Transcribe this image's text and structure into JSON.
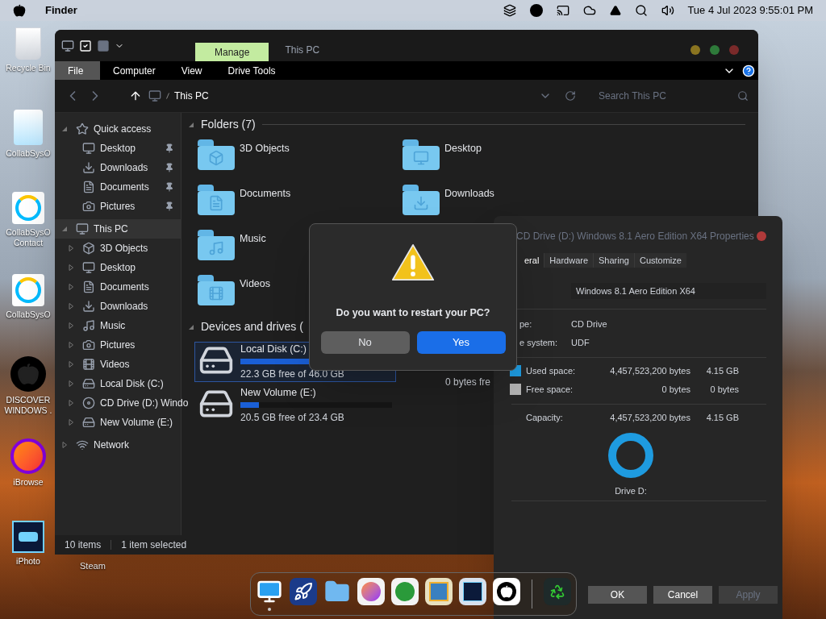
{
  "menu_bar": {
    "app_name": "Finder",
    "clock": "Tue 4 Jul 2023 9:55:01 PM"
  },
  "desktop_icons": [
    {
      "label": "Recycle Bin",
      "kind": "bin"
    },
    {
      "label": "CollabSysO",
      "kind": "doc"
    },
    {
      "label": "CollabSysO Contact",
      "kind": "web"
    },
    {
      "label": "CollabSysO",
      "kind": "web"
    },
    {
      "label": "DISCOVER WINDOWS .",
      "kind": "apple"
    },
    {
      "label": "iBrowse",
      "kind": "fox"
    },
    {
      "label": "iPhoto",
      "kind": "ps"
    }
  ],
  "desktop_icon_below": {
    "label": "Steam"
  },
  "explorer": {
    "context_tab": "Manage",
    "title": "This PC",
    "ribbon_tabs": [
      {
        "label": "File",
        "selected": true
      },
      {
        "label": "Computer",
        "selected": false
      },
      {
        "label": "View",
        "selected": false
      },
      {
        "label": "Drive Tools",
        "selected": false
      }
    ],
    "path": "This PC",
    "search": {
      "placeholder": "Search This PC"
    },
    "sidebar": [
      {
        "label": "Quick access",
        "kind": "star",
        "expanded": true,
        "selected": false,
        "children": [
          {
            "label": "Desktop",
            "kind": "desktop",
            "pinned": true
          },
          {
            "label": "Downloads",
            "kind": "download",
            "pinned": true
          },
          {
            "label": "Documents",
            "kind": "document",
            "pinned": true
          },
          {
            "label": "Pictures",
            "kind": "camera",
            "pinned": true
          }
        ]
      },
      {
        "label": "This PC",
        "kind": "pc",
        "expanded": true,
        "selected": true,
        "children": [
          {
            "label": "3D Objects",
            "kind": "cube",
            "pinned": false
          },
          {
            "label": "Desktop",
            "kind": "desktop",
            "pinned": false
          },
          {
            "label": "Documents",
            "kind": "document",
            "pinned": false
          },
          {
            "label": "Downloads",
            "kind": "download",
            "pinned": false
          },
          {
            "label": "Music",
            "kind": "music",
            "pinned": false
          },
          {
            "label": "Pictures",
            "kind": "camera",
            "pinned": false
          },
          {
            "label": "Videos",
            "kind": "film",
            "pinned": false
          },
          {
            "label": "Local Disk (C:)",
            "kind": "disk",
            "pinned": false
          },
          {
            "label": "CD Drive (D:) Windo",
            "kind": "cd",
            "pinned": false
          },
          {
            "label": "New Volume (E:)",
            "kind": "disk",
            "pinned": false
          }
        ]
      },
      {
        "label": "Network",
        "kind": "network",
        "expanded": false,
        "selected": false
      }
    ],
    "folders_heading": "Folders (7)",
    "folders": [
      {
        "label": "3D Objects",
        "kind": "cube"
      },
      {
        "label": "Documents",
        "kind": "document"
      },
      {
        "label": "Music",
        "kind": "music"
      },
      {
        "label": "Videos",
        "kind": "film"
      },
      {
        "label": "Desktop",
        "kind": "desktop"
      },
      {
        "label": "Downloads",
        "kind": "download"
      }
    ],
    "drives_heading": "Devices and drives (",
    "drives": [
      {
        "name": "Local Disk (C:)",
        "level": 0.52,
        "free": "22.3 GB free of 46.0 GB",
        "selected": true
      },
      {
        "name": "New Volume (E:)",
        "level": 0.12,
        "free": "20.5 GB free of 23.4 GB",
        "selected": false
      }
    ],
    "partial_drive_text": "0 bytes fre",
    "status_bar": {
      "items": "10 items",
      "selection": "1 item selected"
    }
  },
  "restart_dialog": {
    "message": "Do you want to restart your PC?",
    "buttons": [
      {
        "label": "No",
        "primary": false
      },
      {
        "label": "Yes",
        "primary": true
      }
    ]
  },
  "properties": {
    "title": "CD Drive (D:) Windows 8.1 Aero Edition X64 Properties",
    "tabs": [
      {
        "label": "eral",
        "selected": true
      },
      {
        "label": "Hardware",
        "selected": false
      },
      {
        "label": "Sharing",
        "selected": false
      },
      {
        "label": "Customize",
        "selected": false
      }
    ],
    "name_value": "Windows 8.1 Aero Edition X64",
    "info": [
      {
        "label": "pe:",
        "value": "CD Drive"
      },
      {
        "label": "e system:",
        "value": "UDF"
      }
    ],
    "space": [
      {
        "label": "Used space:",
        "bytes": "4,457,523,200 bytes",
        "size": "4.15 GB",
        "color": "#1e9be0"
      },
      {
        "label": "Free space:",
        "bytes": "0 bytes",
        "size": "0 bytes",
        "color": "#b4b4b4"
      }
    ],
    "capacity": {
      "label": "Capacity:",
      "bytes": "4,457,523,200 bytes",
      "size": "4.15 GB"
    },
    "drive_label": "Drive D:",
    "buttons": [
      {
        "label": "OK",
        "disabled": false
      },
      {
        "label": "Cancel",
        "disabled": false
      },
      {
        "label": "Apply",
        "disabled": true
      }
    ]
  },
  "dock": [
    {
      "kind": "monitor",
      "running": true
    },
    {
      "kind": "rocket",
      "running": false
    },
    {
      "kind": "folder",
      "running": false
    },
    {
      "kind": "fox",
      "running": false
    },
    {
      "kind": "torrent",
      "running": false
    },
    {
      "kind": "box",
      "running": false
    },
    {
      "kind": "ps",
      "running": false
    },
    {
      "kind": "apple",
      "running": false
    },
    {
      "kind": "bin",
      "running": false
    }
  ]
}
